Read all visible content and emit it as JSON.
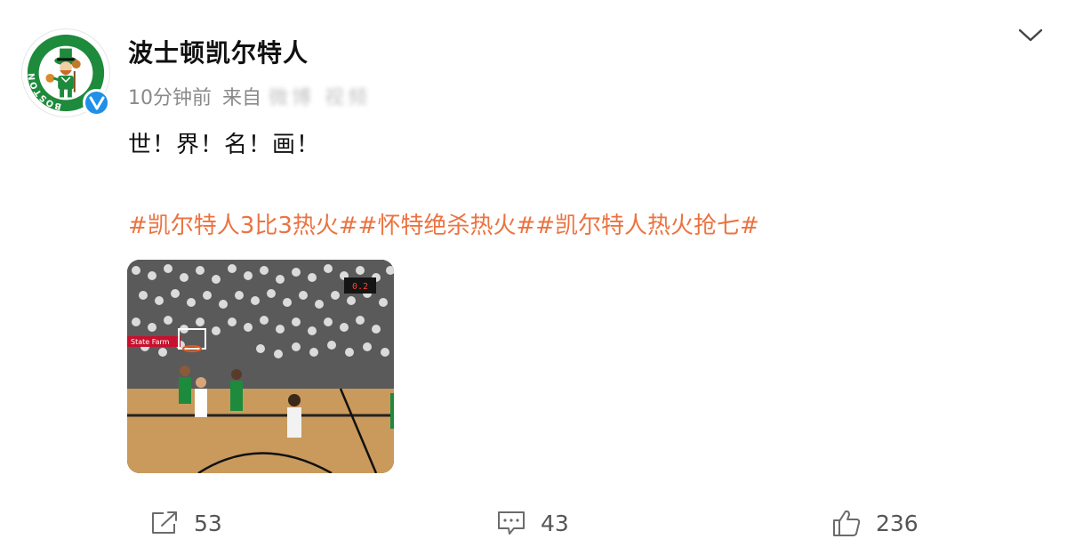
{
  "post": {
    "author": {
      "name": "波士顿凯尔特人",
      "avatar_icon": "celtics-logo-icon",
      "avatar_text": "BOSTON CELTICS",
      "verified_icon": "verified-v-icon",
      "verified_color": "#1f8fe8"
    },
    "meta": {
      "time": "10分钟前",
      "from_label": "来自",
      "source": "微博 视频"
    },
    "more_icon": "chevron-down-icon",
    "text": "世！界！名！画！",
    "hashtags": [
      "#凯尔特人3比3热火#",
      "#怀特绝杀热火#",
      "#凯尔特人热火抢七#"
    ],
    "hashtag_color": "#eb7340",
    "media": {
      "type": "image",
      "description_icon": "basketball-game-photo",
      "sponsor_text": "State Farm",
      "scoreboard_text": "0.2"
    },
    "actions": [
      {
        "name": "repost",
        "icon": "repost-icon",
        "count": "53"
      },
      {
        "name": "comment",
        "icon": "comment-icon",
        "count": "43"
      },
      {
        "name": "like",
        "icon": "thumbs-up-icon",
        "count": "236"
      }
    ]
  }
}
